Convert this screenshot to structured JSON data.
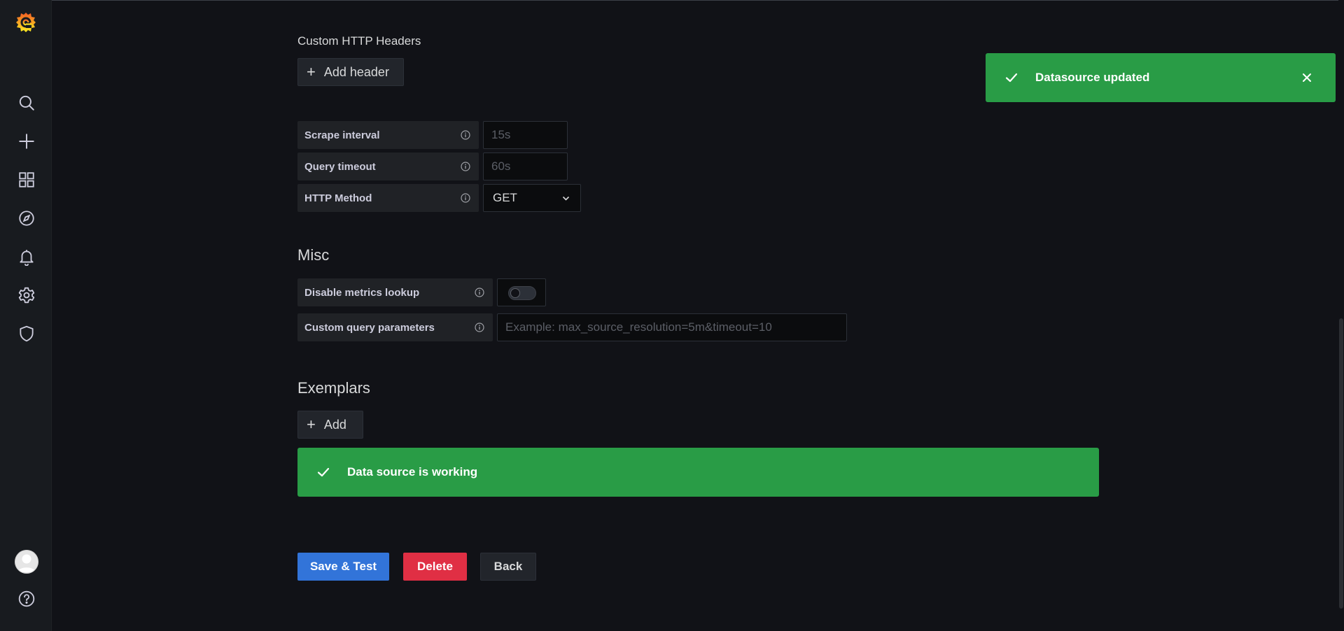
{
  "sidebar": {
    "icons": [
      "grafana-logo-icon",
      "search-icon",
      "plus-icon",
      "dashboards-icon",
      "explore-compass-icon",
      "alerting-bell-icon",
      "configuration-gear-icon",
      "server-admin-shield-icon",
      "user-avatar",
      "help-icon"
    ]
  },
  "http_headers": {
    "title": "Custom HTTP Headers",
    "add_label": "Add header"
  },
  "fields": {
    "scrape_interval": {
      "label": "Scrape interval",
      "placeholder": "15s"
    },
    "query_timeout": {
      "label": "Query timeout",
      "placeholder": "60s"
    },
    "http_method": {
      "label": "HTTP Method",
      "value": "GET"
    }
  },
  "misc": {
    "title": "Misc",
    "disable_metrics_lookup": {
      "label": "Disable metrics lookup",
      "enabled": false
    },
    "custom_query_parameters": {
      "label": "Custom query parameters",
      "placeholder": "Example: max_source_resolution=5m&timeout=10"
    }
  },
  "exemplars": {
    "title": "Exemplars",
    "add_label": "Add"
  },
  "status_alert": {
    "text": "Data source is working",
    "color": "#299c46"
  },
  "actions": {
    "save_test": "Save & Test",
    "delete": "Delete",
    "back": "Back"
  },
  "toast": {
    "text": "Datasource updated"
  },
  "colors": {
    "success": "#299c46",
    "primary": "#3274d9",
    "danger": "#e02f44",
    "background": "#111217"
  }
}
